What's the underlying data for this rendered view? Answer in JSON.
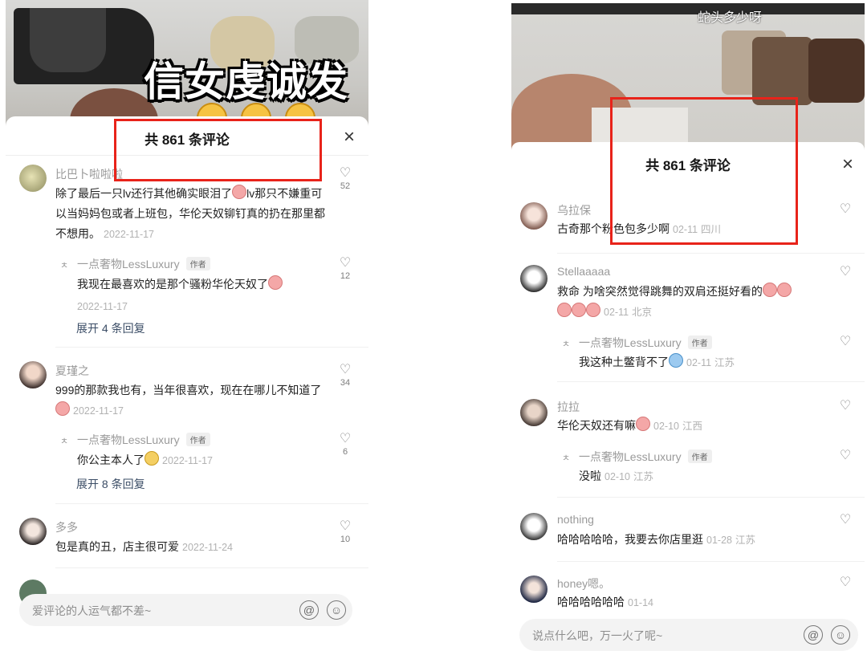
{
  "left": {
    "video_caption": "信女虔诚发愿",
    "header_title": "共 861 条评论",
    "close_icon": "close-icon",
    "comments": [
      {
        "username": "比巴卜啦啦啦",
        "text": "除了最后一只lv还行其他确实眼泪了",
        "text2": "lv那只不嫌重可以当妈妈包或者上班包，华伦天奴铆钉真的扔在那里都不想用。",
        "date": "2022-11-17",
        "likes": "52",
        "reply": {
          "username": "一点奢物LessLuxury",
          "badge": "作者",
          "text": "我现在最喜欢的是那个骚粉华伦天奴了",
          "date": "2022-11-17",
          "likes": "12"
        },
        "expand": "展开 4 条回复"
      },
      {
        "username": "夏瑾之",
        "text": "999的那款我也有，当年很喜欢，现在在哪儿不知道了",
        "date": "2022-11-17",
        "likes": "34",
        "reply": {
          "username": "一点奢物LessLuxury",
          "badge": "作者",
          "text": "你公主本人了",
          "date": "2022-11-17",
          "likes": "6"
        },
        "expand": "展开 8 条回复"
      },
      {
        "username": "多多",
        "text": "包是真的丑，店主很可爱",
        "date": "2022-11-24",
        "likes": "10"
      }
    ],
    "input_placeholder": "爱评论的人运气都不差~"
  },
  "right": {
    "video_caption": "蛇头多少呀",
    "header_title": "共 861 条评论",
    "comments": [
      {
        "username": "乌拉保",
        "text": "古奇那个粉色包多少啊",
        "date": "02-11",
        "location": "四川"
      },
      {
        "username": "Stellaaaaa",
        "text": "救命 为啥突然觉得跳舞的双肩还挺好看的",
        "date": "02-11",
        "location": "北京",
        "reply": {
          "username": "一点奢物LessLuxury",
          "badge": "作者",
          "text": "我这种土鳖背不了",
          "date": "02-11",
          "location": "江苏"
        }
      },
      {
        "username": "拉拉",
        "text": "华伦天奴还有嘛",
        "date": "02-10",
        "location": "江西",
        "reply": {
          "username": "一点奢物LessLuxury",
          "badge": "作者",
          "text": "没啦",
          "date": "02-10",
          "location": "江苏"
        }
      },
      {
        "username": "nothing",
        "text": "哈哈哈哈哈，我要去你店里逛",
        "date": "01-28",
        "location": "江苏"
      },
      {
        "username": "honey嗯。",
        "text": "哈哈哈哈哈哈",
        "date": "01-14"
      }
    ],
    "input_placeholder": "说点什么吧，万一火了呢~"
  },
  "icons": {
    "heart": "♡",
    "at": "@",
    "emoji": "☺",
    "close": "×",
    "reply_marker": "ㅊ"
  },
  "colors": {
    "annotation_red": "#e8231a",
    "expand_link": "#3b4d66"
  }
}
